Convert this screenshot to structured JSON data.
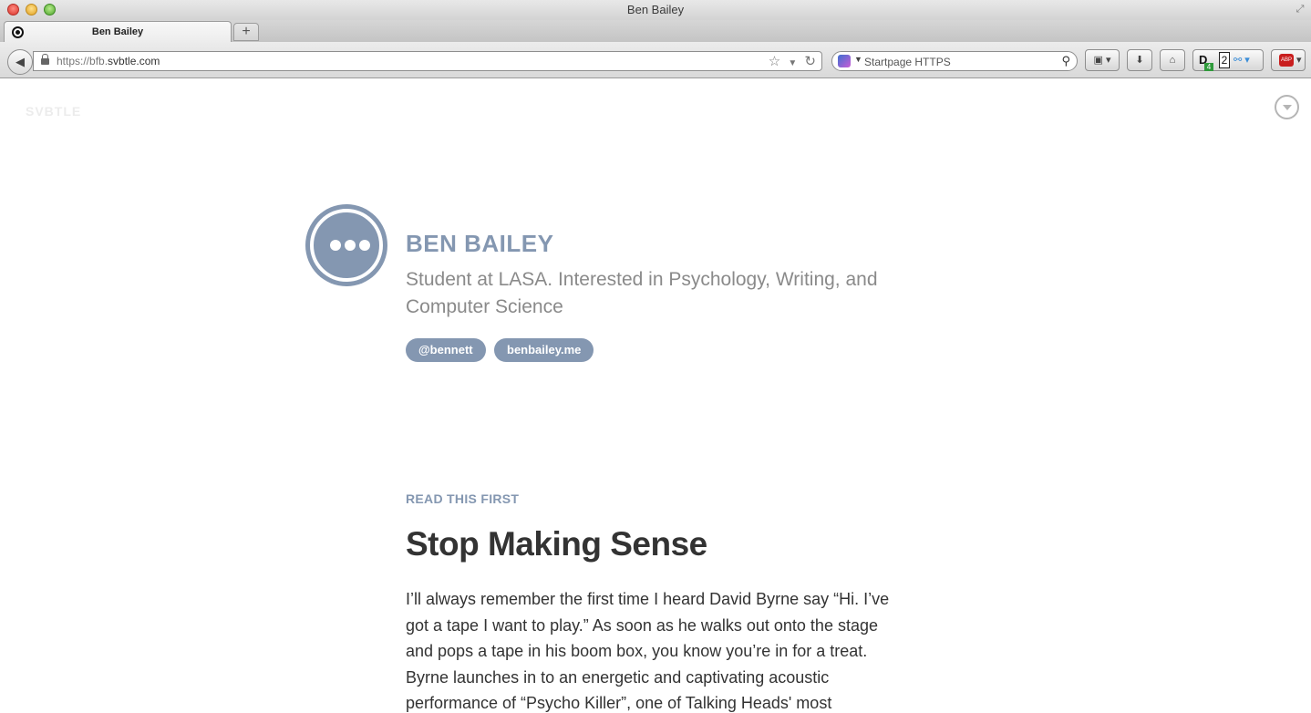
{
  "window": {
    "title": "Ben Bailey"
  },
  "tabs": [
    {
      "label": "Ben Bailey"
    }
  ],
  "newtab": {
    "label": "+"
  },
  "navbar": {
    "back_label": "◀",
    "url_scheme": "https://bfb.",
    "url_host": "svbtle.com",
    "search_placeholder": "Startpage HTTPS",
    "download_badge": "4",
    "counter_badge": "2"
  },
  "page": {
    "logo": "SVBTLE",
    "author": {
      "name": "BEN BAILEY",
      "bio": "Student at LASA. Interested in Psychology, Writing, and Computer Science",
      "links": [
        "@bennett",
        "benbailey.me"
      ]
    },
    "featured_label": "READ THIS FIRST",
    "post": {
      "title": "Stop Making Sense",
      "lines": [
        "I’ll always remember the first time I heard David Byrne say “Hi. I’ve",
        "got a tape I want to play.” As soon as he walks out onto the stage",
        "and pops a tape in his boom box, you know you’re in for a treat.",
        "Byrne launches in to an energetic and captivating acoustic",
        "performance of “Psycho Killer”, one of Talking Heads' most"
      ]
    }
  },
  "colors": {
    "accent": "#8497b1",
    "text": "#333333",
    "muted": "#8a8a8a"
  }
}
